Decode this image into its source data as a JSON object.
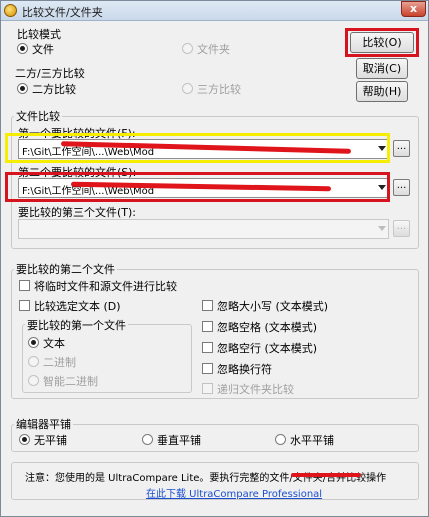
{
  "window": {
    "title": "比较文件/文件夹",
    "close_label": "x"
  },
  "compare_mode": {
    "label": "比较模式",
    "options": [
      "文件",
      "文件夹"
    ],
    "selected": "文件"
  },
  "way_compare": {
    "label": "二方/三方比较",
    "options": [
      "二方比较",
      "三方比较"
    ],
    "selected": "二方比较"
  },
  "buttons": {
    "compare": "比较(O)",
    "cancel": "取消(C)",
    "help": "帮助(H)"
  },
  "file_compare": {
    "label": "文件比较",
    "first_label": "第一个要比较的文件(F):",
    "first_value": "F:\\Git\\工作空间\\...\\Web\\Mod",
    "second_label": "第二个要比较的文件(S):",
    "second_value": "F:\\Git\\工作空间\\...\\Web\\Mod",
    "third_label": "要比较的第三个文件(T):",
    "third_value": "",
    "browse_label": "..."
  },
  "second_file_options": {
    "label": "要比较的第二个文件",
    "temp_compare": "将临时文件和源文件进行比较",
    "compare_selected": "比较选定文本 (D)",
    "first_file_group": {
      "label": "要比较的第一个文件",
      "options": [
        "文本",
        "二进制",
        "智能二进制"
      ],
      "selected": "文本"
    },
    "ignore_case": "忽略大小写 (文本模式)",
    "ignore_spaces": "忽略空格 (文本模式)",
    "ignore_blank": "忽略空行 (文本模式)",
    "ignore_newline": "忽略换行符",
    "recurse_folders": "递归文件夹比较"
  },
  "editor_tile": {
    "label": "编辑器平铺",
    "options": [
      "无平铺",
      "垂直平铺",
      "水平平铺"
    ],
    "selected": "无平铺"
  },
  "notice": {
    "text": "注意：您使用的是 UltraCompare Lite。要执行完整的文件/文件夹/合并比较操作",
    "link": "在此下载 UltraCompare Professional"
  },
  "colors": {
    "highlight_red": "#d7141d",
    "highlight_yellow": "#f5ee00",
    "redaction": "#e0141b",
    "link": "#1a4fd0"
  }
}
